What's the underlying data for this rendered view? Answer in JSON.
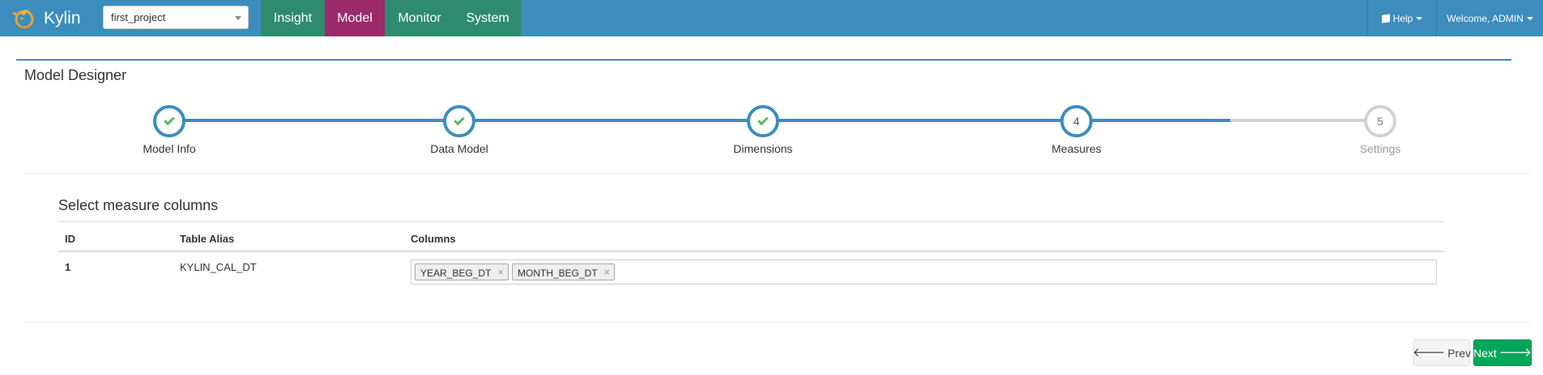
{
  "navbar": {
    "brand": "Kylin",
    "project_select": {
      "value": "first_project"
    },
    "tabs": [
      {
        "label": "Insight"
      },
      {
        "label": "Model"
      },
      {
        "label": "Monitor"
      },
      {
        "label": "System"
      }
    ],
    "active_tab": "Model",
    "help_label": "Help",
    "welcome_label": "Welcome, ADMIN"
  },
  "page": {
    "title": "Model Designer"
  },
  "wizard": {
    "steps": [
      {
        "label": "Model Info",
        "number": "1",
        "state": "done"
      },
      {
        "label": "Data Model",
        "number": "2",
        "state": "done"
      },
      {
        "label": "Dimensions",
        "number": "3",
        "state": "done"
      },
      {
        "label": "Measures",
        "number": "4",
        "state": "current"
      },
      {
        "label": "Settings",
        "number": "5",
        "state": "todo"
      }
    ]
  },
  "measures": {
    "title": "Select measure columns",
    "headers": {
      "id": "ID",
      "alias": "Table Alias",
      "columns": "Columns"
    },
    "rows": [
      {
        "id": "1",
        "alias": "KYLIN_CAL_DT",
        "columns": [
          "YEAR_BEG_DT",
          "MONTH_BEG_DT"
        ]
      }
    ]
  },
  "buttons": {
    "prev": "Prev",
    "next": "Next"
  },
  "colors": {
    "navbar": "#3c8dbc",
    "tab_default": "#2e8b6e",
    "tab_active": "#9b2a6a",
    "step_done": "#3c8dbc",
    "step_todo": "#d2d2d2",
    "check": "#5cb85c",
    "next_button": "#00a65a"
  },
  "icons": {
    "brand": "kylin-logo-icon",
    "help": "book-icon",
    "prev": "arrow-left-icon",
    "next": "arrow-right-icon",
    "tag_remove": "close-icon",
    "step_done": "check-icon"
  }
}
